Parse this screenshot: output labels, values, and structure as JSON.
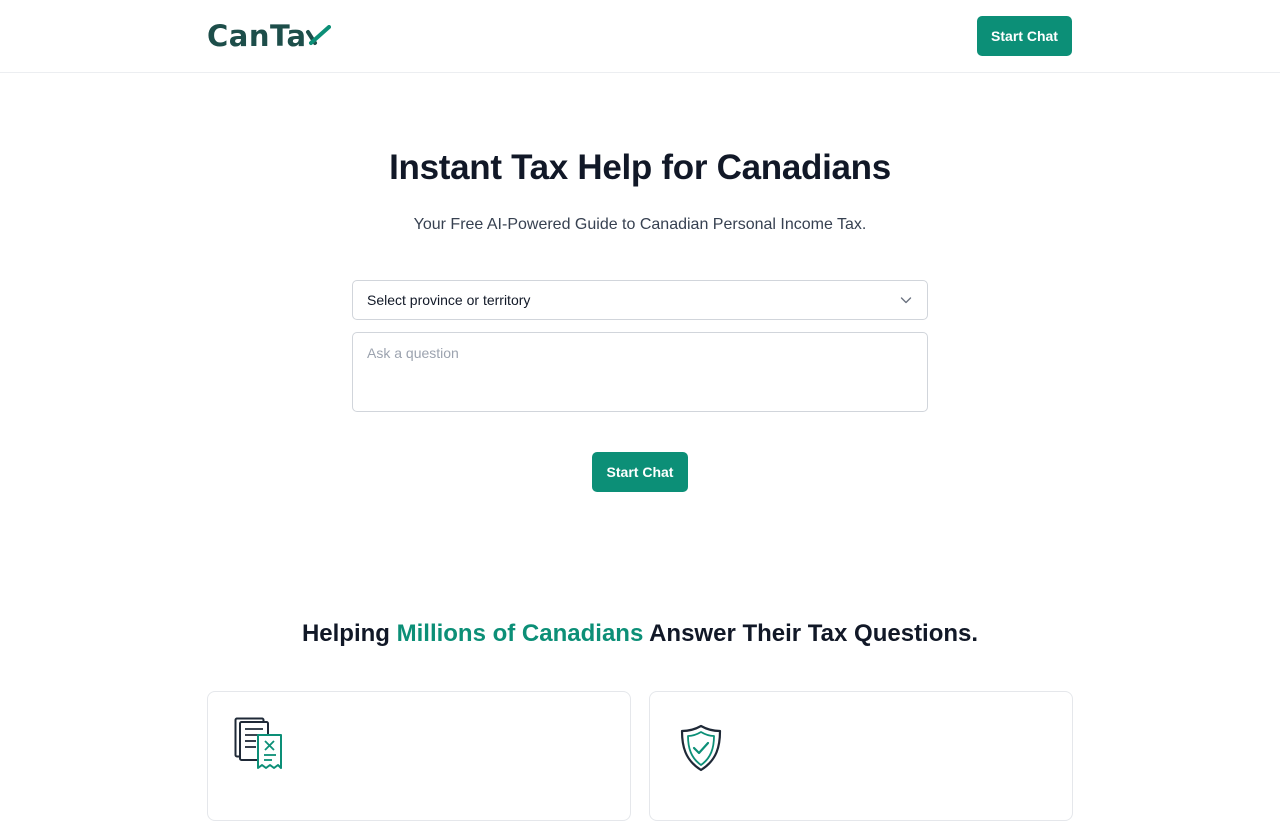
{
  "header": {
    "logo_text": "CanTa",
    "cta_label": "Start Chat"
  },
  "hero": {
    "title": "Instant Tax Help for Canadians",
    "subtitle": "Your Free AI-Powered Guide to Canadian Personal Income Tax.",
    "province_select": {
      "selected": "Select province or territory"
    },
    "question_input": {
      "placeholder": "Ask a question",
      "value": ""
    },
    "cta_label": "Start Chat"
  },
  "features": {
    "heading_prefix": "Helping ",
    "heading_highlight": "Millions of Canadians",
    "heading_suffix": " Answer Their Tax Questions.",
    "cards": [
      {
        "icon": "tax-documents-icon"
      },
      {
        "icon": "shield-check-icon"
      }
    ]
  },
  "colors": {
    "brand": "#1d4e4a",
    "accent": "#0c8f77",
    "text": "#111827"
  }
}
